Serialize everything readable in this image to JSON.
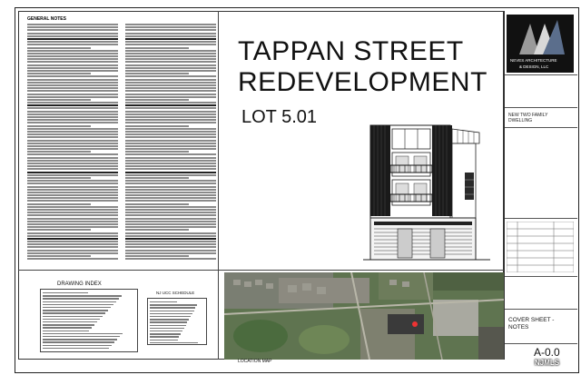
{
  "notes": {
    "heading": "GENERAL NOTES"
  },
  "title": {
    "line1": "TAPPAN STREET",
    "line2": "REDEVELOPMENT",
    "lot": "LOT 5.01"
  },
  "titleblock": {
    "firm_line1": "NEVES ARCHITECTURE",
    "firm_line2": "& DESIGN, LLC",
    "project_name": "NEW TWO FAMILY DWELLING",
    "sheet_title": "COVER SHEET - NOTES",
    "sheet_number": "A-0.0"
  },
  "drawing_index": {
    "title": "DRAWING INDEX"
  },
  "ucc": {
    "title": "NJ UCC SCHEDULE"
  },
  "map": {
    "label": "LOCATION MAP"
  },
  "watermark": "NJMLS",
  "colors": {
    "map_green": "#5f7450",
    "building_dark": "#1a1a1a"
  }
}
